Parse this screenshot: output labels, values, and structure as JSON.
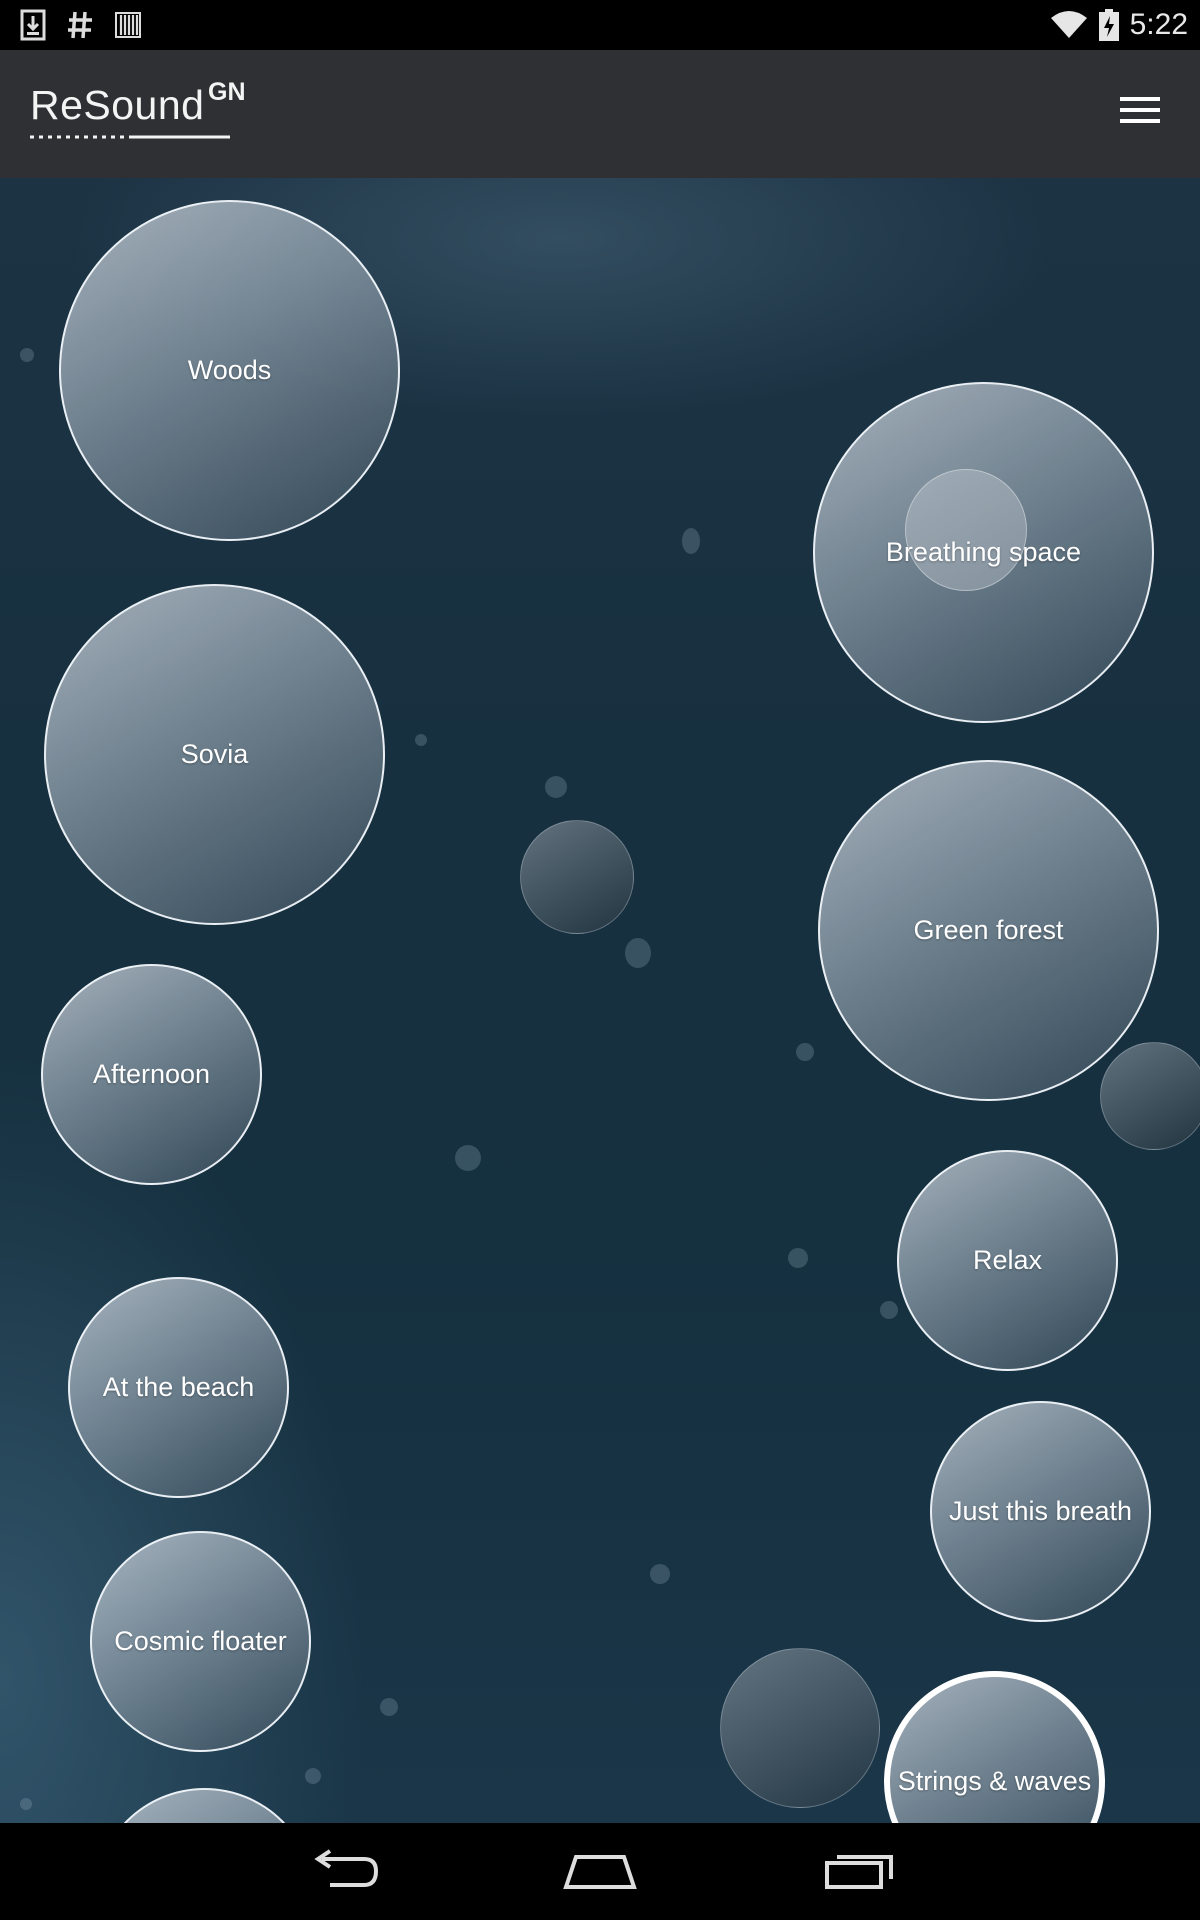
{
  "status_bar": {
    "time": "5:22",
    "icons": [
      "download-icon",
      "hash-icon",
      "barcode-icon",
      "wifi-icon",
      "battery-charging-icon"
    ]
  },
  "app_bar": {
    "logo_text": "ReSound",
    "logo_superscript": "GN",
    "menu_icon": "hamburger-menu-icon"
  },
  "bubbles": [
    {
      "label": "Woods"
    },
    {
      "label": "Sovia"
    },
    {
      "label": "Afternoon"
    },
    {
      "label": "At the beach"
    },
    {
      "label": "Cosmic floater"
    },
    {
      "label": "Breathing space"
    },
    {
      "label": "Green forest"
    },
    {
      "label": "Relax"
    },
    {
      "label": "Just this breath"
    },
    {
      "label": "Strings & waves",
      "selected": true
    }
  ],
  "nav_bar": {
    "icons": [
      "back-icon",
      "home-icon",
      "recent-apps-icon"
    ]
  },
  "colors": {
    "background_dark": "#15303f",
    "app_bar": "#2e3033",
    "bubble_border": "#f0f5fa",
    "text": "#ffffff"
  }
}
